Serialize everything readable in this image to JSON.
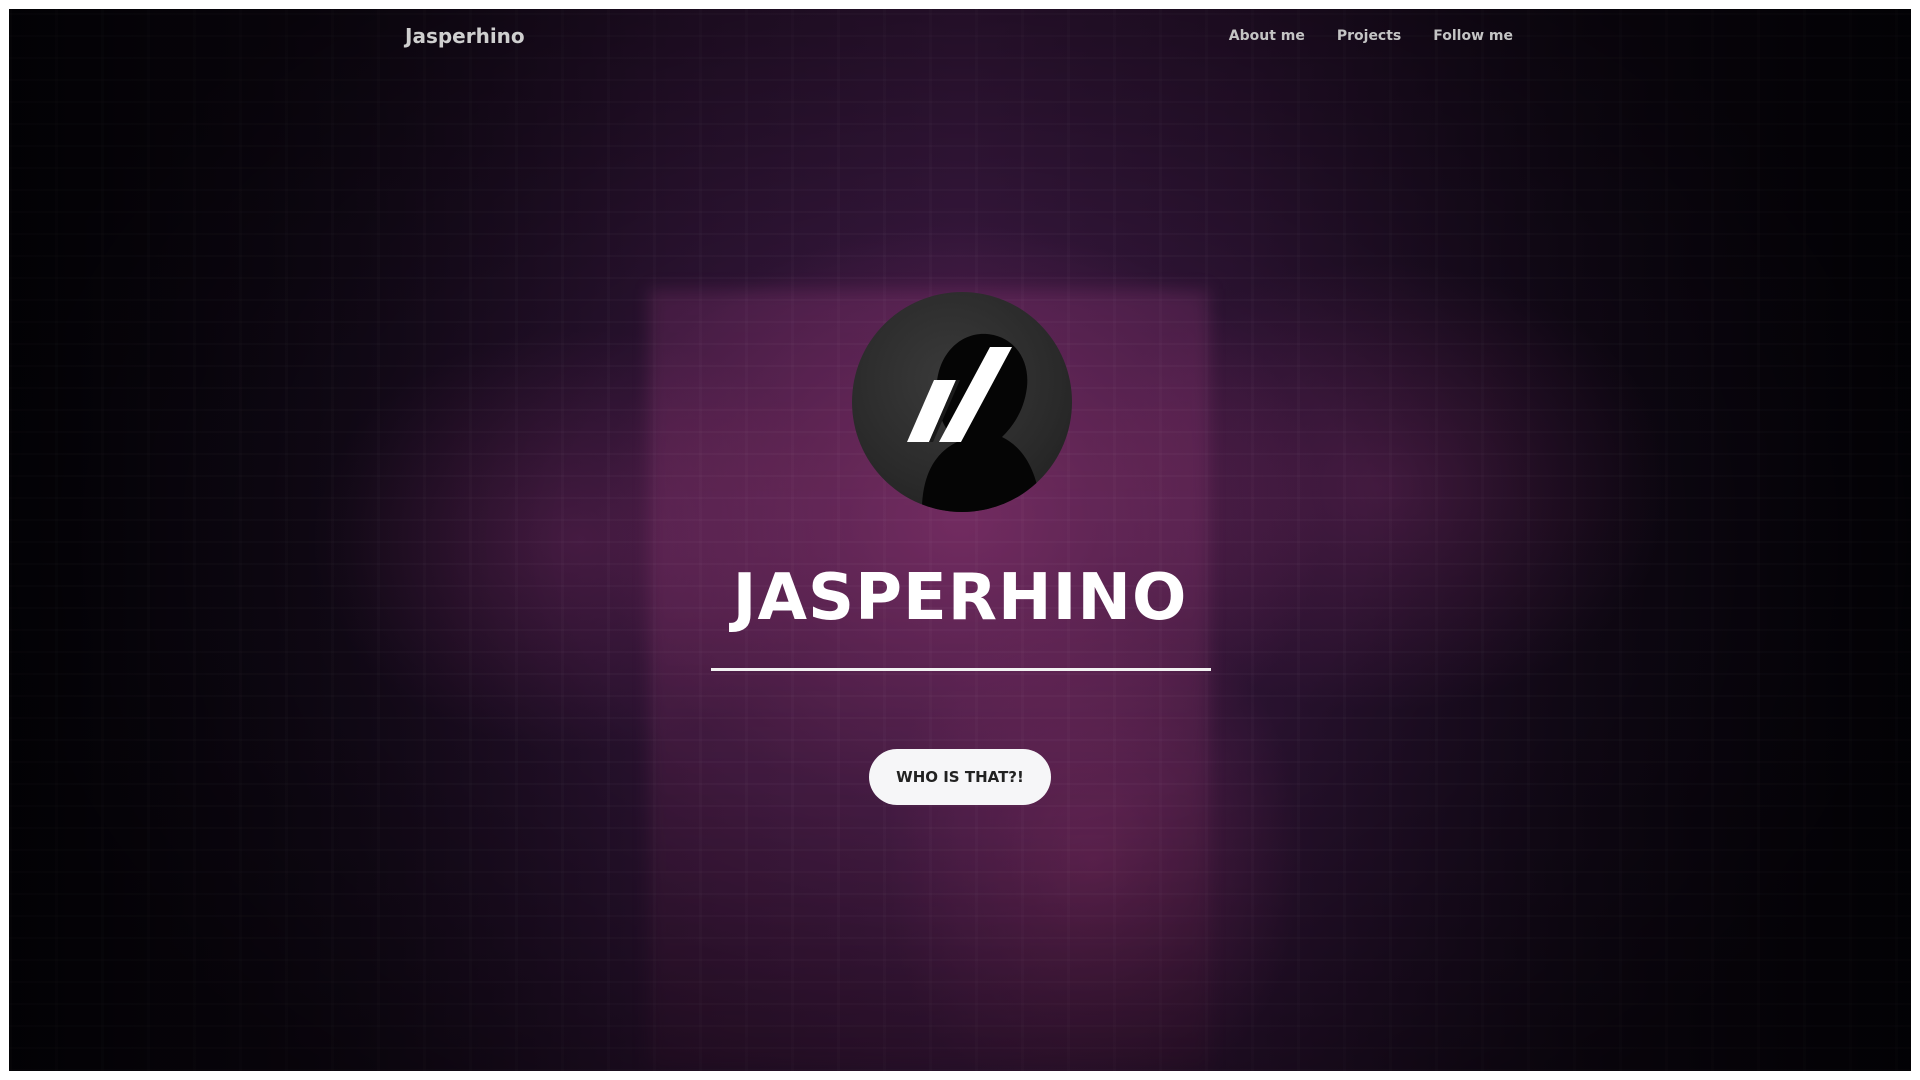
{
  "navbar": {
    "brand": "Jasperhino",
    "links": [
      {
        "label": "About me"
      },
      {
        "label": "Projects"
      },
      {
        "label": "Follow me"
      }
    ]
  },
  "hero": {
    "title": "JASPERHINO",
    "cta_label": "WHO IS THAT?!",
    "avatar_icon": "slash-logo-icon"
  },
  "colors": {
    "background": "#06030a",
    "accent_glow": "#8c326e",
    "text": "#ffffff",
    "button_bg": "#f6f6f8",
    "button_text": "#222222"
  }
}
